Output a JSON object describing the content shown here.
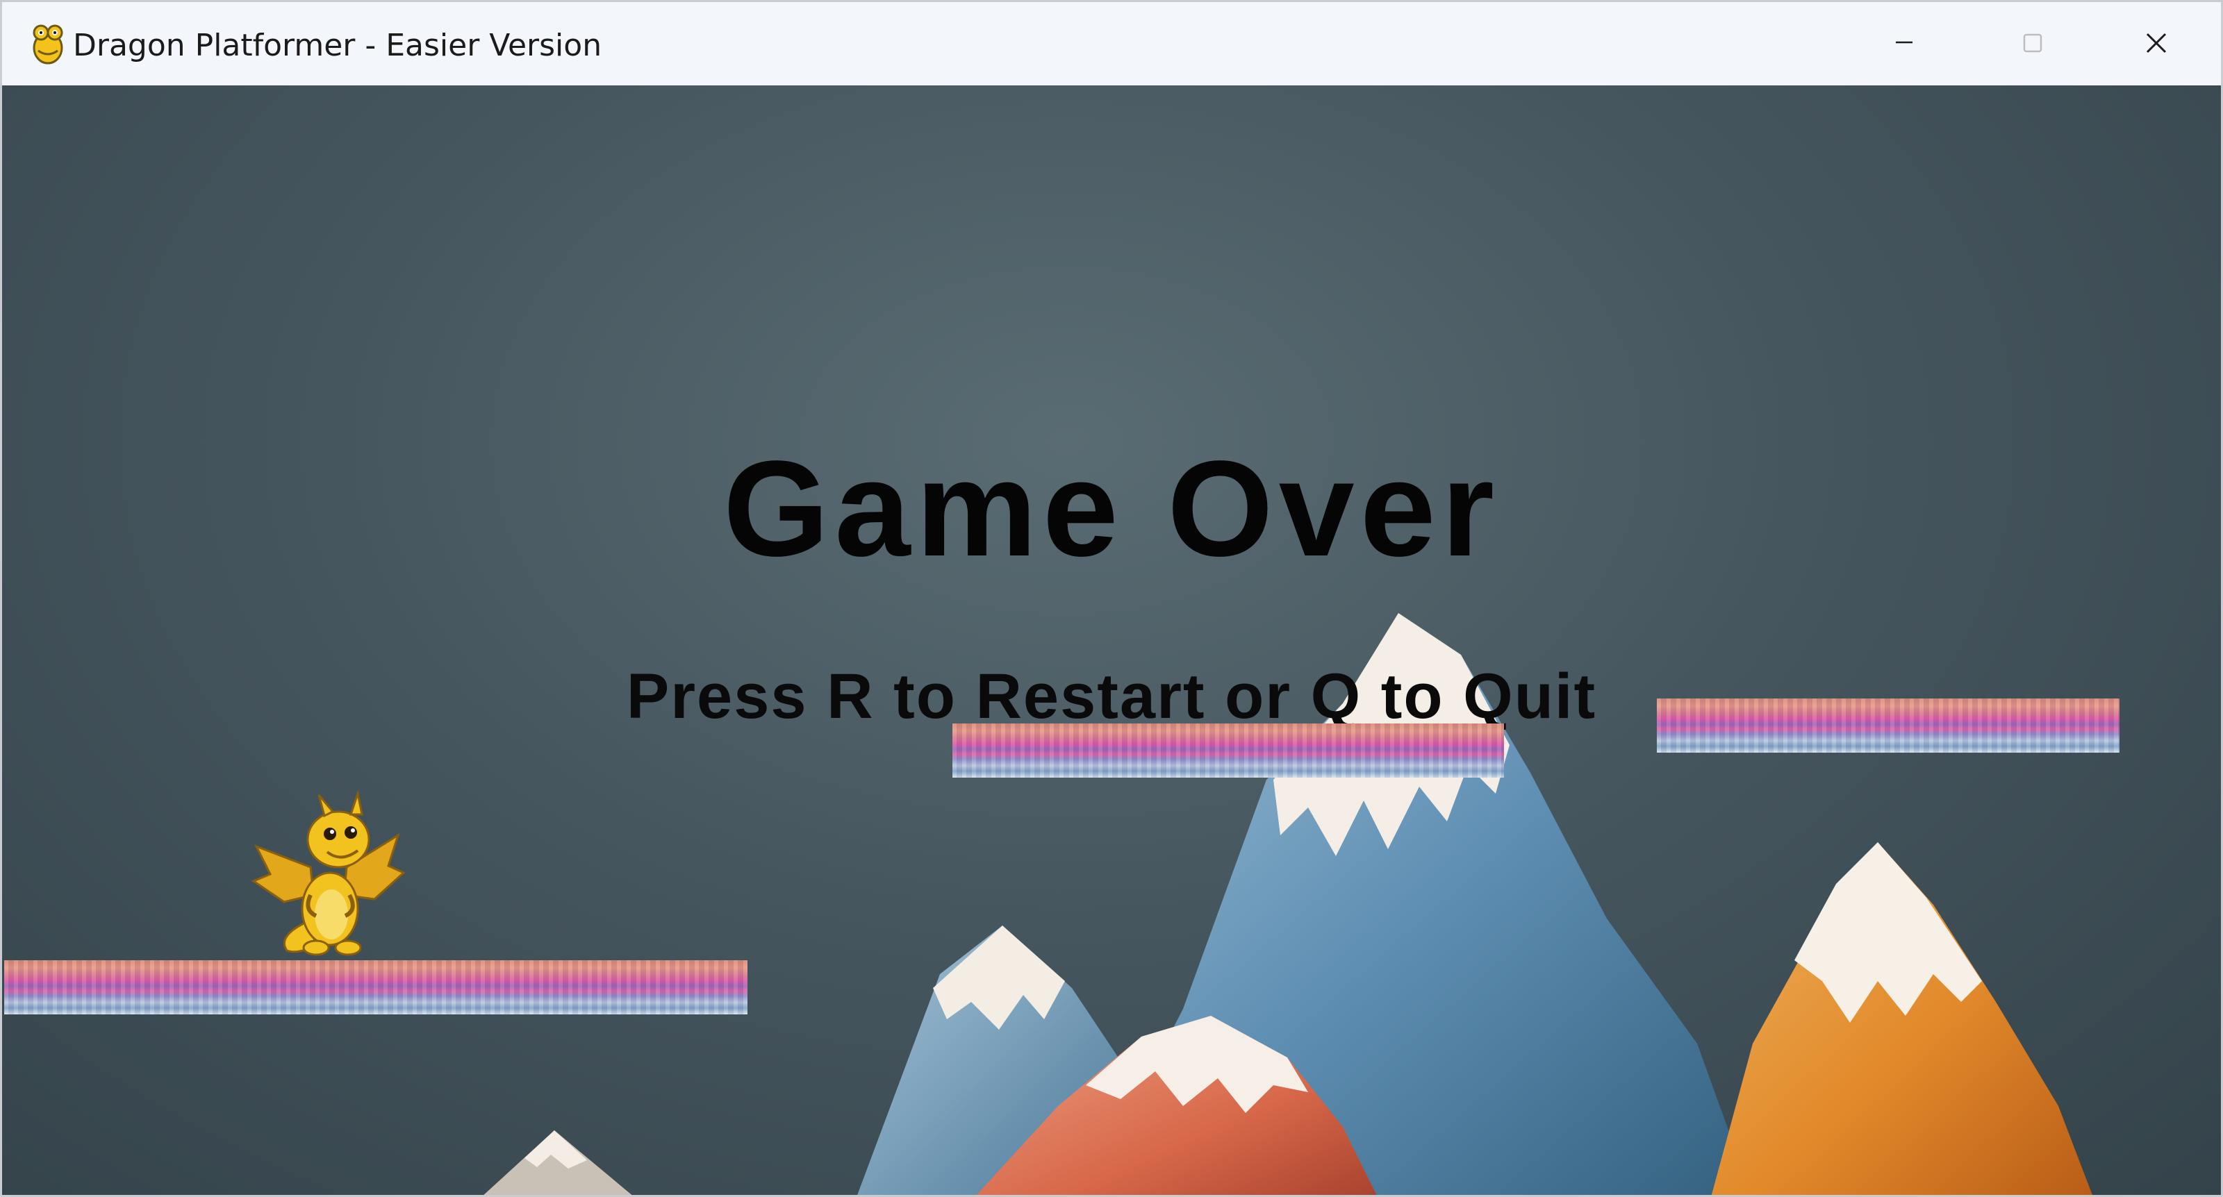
{
  "window": {
    "title": "Dragon Platformer - Easier Version",
    "icon": "pygame-snake-icon",
    "controls": {
      "minimize": "minimize-icon",
      "maximize": "maximize-icon",
      "close": "close-icon"
    }
  },
  "game": {
    "headline": "Game Over",
    "prompt": "Press R to Restart or Q to Quit",
    "background": "snow-capped-mountains",
    "player": "yellow-dragon",
    "colors": {
      "background": "#46565e",
      "text": "#050505",
      "platform_pink": "#e05aa7",
      "dragon": "#f2c21f"
    }
  }
}
